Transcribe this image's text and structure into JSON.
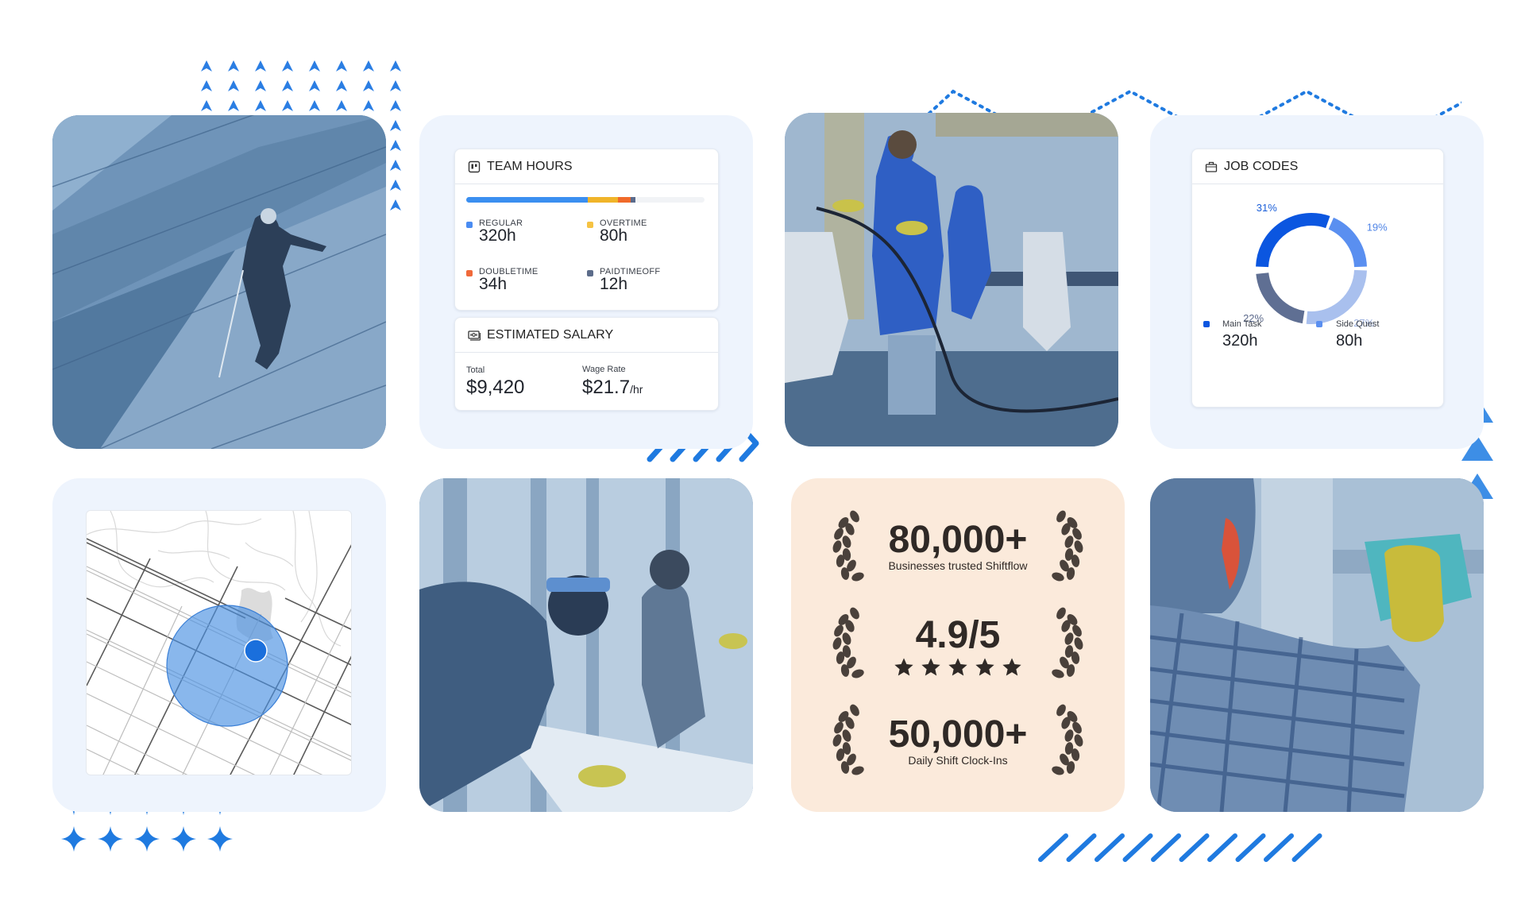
{
  "team_hours": {
    "title": "TEAM HOURS",
    "icon": "board-icon",
    "bar_segments": [
      {
        "name": "regular",
        "hours": 320,
        "color": "#3b8ff0"
      },
      {
        "name": "overtime",
        "hours": 80,
        "color": "#f0b429"
      },
      {
        "name": "doubletime",
        "hours": 34,
        "color": "#f06a2a"
      },
      {
        "name": "paidtimeoff",
        "hours": 12,
        "color": "#5a6b8c"
      }
    ],
    "bar_total_capacity_fraction": 0.71,
    "items": [
      {
        "label": "REGULAR",
        "value": "320h",
        "color": "#4a8cf2"
      },
      {
        "label": "OVERTIME",
        "value": "80h",
        "color": "#f6c343"
      },
      {
        "label": "DOUBLETIME",
        "value": "34h",
        "color": "#f0693a"
      },
      {
        "label": "PAIDTIMEOFF",
        "value": "12h",
        "color": "#5c6c8a"
      }
    ]
  },
  "estimated_salary": {
    "title": "ESTIMATED SALARY",
    "icon": "money-icon",
    "total_label": "Total",
    "total_value": "$9,420",
    "wage_label": "Wage Rate",
    "wage_value": "$21.7",
    "wage_unit": "/hr"
  },
  "job_codes": {
    "title": "JOB CODES",
    "icon": "briefcase-icon",
    "segments": [
      {
        "percent": 31,
        "label": "31%",
        "color": "#0b56e0",
        "label_color": "#1b5fd9"
      },
      {
        "percent": 19,
        "label": "19%",
        "color": "#5a8ff0",
        "label_color": "#4f84e6"
      },
      {
        "percent": 27,
        "label": "27%",
        "color": "#a9c0ee",
        "label_color": "#9fb3e0"
      },
      {
        "percent": 22,
        "label": "22%",
        "color": "#5f6f93",
        "label_color": "#5d6a8c"
      }
    ],
    "legend": [
      {
        "label": "Main Task",
        "value": "320h",
        "color": "#0b56e0"
      },
      {
        "label": "Side Quest",
        "value": "80h",
        "color": "#5a8ff0"
      }
    ]
  },
  "stats": {
    "items": [
      {
        "value": "80,000+",
        "caption": "Businesses trusted Shiftflow"
      },
      {
        "value": "4.9/5",
        "rating": 5
      },
      {
        "value": "50,000+",
        "caption": "Daily Shift Clock-Ins"
      }
    ]
  },
  "photos": [
    {
      "name": "photo-rope-access-window-cleaner"
    },
    {
      "name": "photo-office-cleaning-team"
    },
    {
      "name": "photo-table-wiping-workers"
    },
    {
      "name": "photo-glass-cleaning-glove"
    }
  ],
  "map": {
    "name": "geofence-map"
  },
  "colors": {
    "accent": "#1f7ae0",
    "panel": "#eef4fd",
    "stats_bg": "#fbeadb"
  }
}
